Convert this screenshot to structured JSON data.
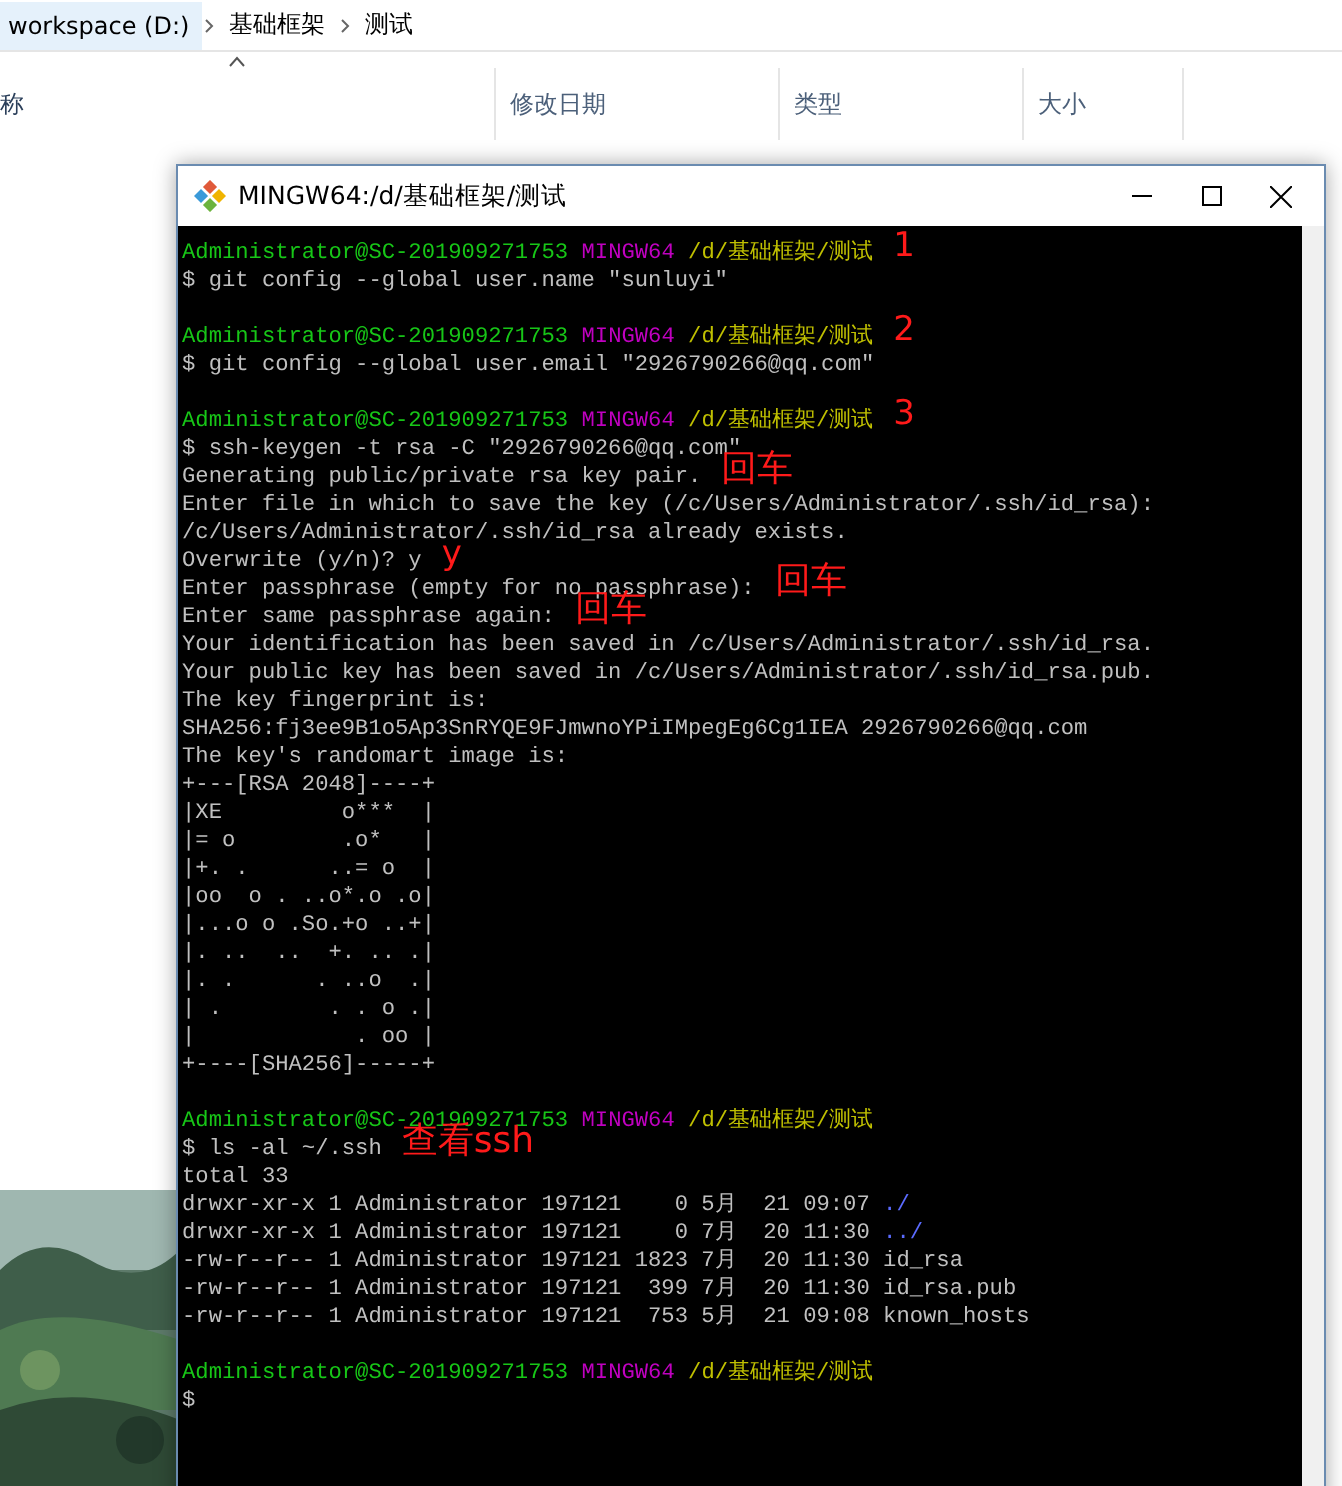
{
  "explorer": {
    "breadcrumb": [
      "workspace (D:)",
      "基础框架",
      "测试"
    ],
    "columns": [
      {
        "label": "称",
        "sorted": true
      },
      {
        "label": "修改日期",
        "sorted": false
      },
      {
        "label": "类型",
        "sorted": false
      },
      {
        "label": "大小",
        "sorted": false
      }
    ]
  },
  "terminal": {
    "title": "MINGW64:/d/基础框架/测试",
    "lines": [
      {
        "kind": "prompt",
        "user": "Administrator@SC-201909271753",
        "shell": "MINGW64",
        "path": "/d/基础框架/测试",
        "note": "1"
      },
      {
        "kind": "text",
        "text": "$ git config --global user.name \"sunluyi\""
      },
      {
        "kind": "blank"
      },
      {
        "kind": "prompt",
        "user": "Administrator@SC-201909271753",
        "shell": "MINGW64",
        "path": "/d/基础框架/测试",
        "note": "2"
      },
      {
        "kind": "text",
        "text": "$ git config --global user.email \"2926790266@qq.com\""
      },
      {
        "kind": "blank"
      },
      {
        "kind": "prompt",
        "user": "Administrator@SC-201909271753",
        "shell": "MINGW64",
        "path": "/d/基础框架/测试",
        "note": "3"
      },
      {
        "kind": "text",
        "text": "$ ssh-keygen -t rsa -C \"2926790266@qq.com\""
      },
      {
        "kind": "text",
        "text": "Generating public/private rsa key pair.",
        "note": "回车"
      },
      {
        "kind": "text",
        "text": "Enter file in which to save the key (/c/Users/Administrator/.ssh/id_rsa):"
      },
      {
        "kind": "text",
        "text": "/c/Users/Administrator/.ssh/id_rsa already exists."
      },
      {
        "kind": "text",
        "text": "Overwrite (y/n)? y",
        "note": "y"
      },
      {
        "kind": "text",
        "text": "Enter passphrase (empty for no passphrase):",
        "note": "回车"
      },
      {
        "kind": "text",
        "text": "Enter same passphrase again:",
        "note": "回车"
      },
      {
        "kind": "text",
        "text": "Your identification has been saved in /c/Users/Administrator/.ssh/id_rsa."
      },
      {
        "kind": "text",
        "text": "Your public key has been saved in /c/Users/Administrator/.ssh/id_rsa.pub."
      },
      {
        "kind": "text",
        "text": "The key fingerprint is:"
      },
      {
        "kind": "text",
        "text": "SHA256:fj3ee9B1o5Ap3SnRYQE9FJmwnoYPiIMpegEg6Cg1IEA 2926790266@qq.com"
      },
      {
        "kind": "text",
        "text": "The key's randomart image is:"
      },
      {
        "kind": "text",
        "text": "+---[RSA 2048]----+"
      },
      {
        "kind": "text",
        "text": "|XE         o***  |"
      },
      {
        "kind": "text",
        "text": "|= o        .o*   |"
      },
      {
        "kind": "text",
        "text": "|+. .      ..= o  |"
      },
      {
        "kind": "text",
        "text": "|oo  o . ..o*.o .o|"
      },
      {
        "kind": "text",
        "text": "|...o o .So.+o ..+|"
      },
      {
        "kind": "text",
        "text": "|. ..  ..  +. .. .|"
      },
      {
        "kind": "text",
        "text": "|. .      . ..o  .|"
      },
      {
        "kind": "text",
        "text": "| .        . . o .|"
      },
      {
        "kind": "text",
        "text": "|            . oo |"
      },
      {
        "kind": "text",
        "text": "+----[SHA256]-----+"
      },
      {
        "kind": "blank"
      },
      {
        "kind": "prompt",
        "user": "Administrator@SC-201909271753",
        "shell": "MINGW64",
        "path": "/d/基础框架/测试"
      },
      {
        "kind": "text",
        "text": "$ ls -al ~/.ssh",
        "note": "查看ssh"
      },
      {
        "kind": "text",
        "text": "total 33"
      },
      {
        "kind": "listing",
        "meta": "drwxr-xr-x 1 Administrator 197121    0 5月  21 09:07 ",
        "name": "./",
        "directory": true
      },
      {
        "kind": "listing",
        "meta": "drwxr-xr-x 1 Administrator 197121    0 7月  20 11:30 ",
        "name": "../",
        "directory": true
      },
      {
        "kind": "listing",
        "meta": "-rw-r--r-- 1 Administrator 197121 1823 7月  20 11:30 ",
        "name": "id_rsa",
        "directory": false
      },
      {
        "kind": "listing",
        "meta": "-rw-r--r-- 1 Administrator 197121  399 7月  20 11:30 ",
        "name": "id_rsa.pub",
        "directory": false
      },
      {
        "kind": "listing",
        "meta": "-rw-r--r-- 1 Administrator 197121  753 5月  21 09:08 ",
        "name": "known_hosts",
        "directory": false
      },
      {
        "kind": "blank"
      },
      {
        "kind": "prompt",
        "user": "Administrator@SC-201909271753",
        "shell": "MINGW64",
        "path": "/d/基础框架/测试"
      },
      {
        "kind": "text",
        "text": "$"
      }
    ]
  }
}
